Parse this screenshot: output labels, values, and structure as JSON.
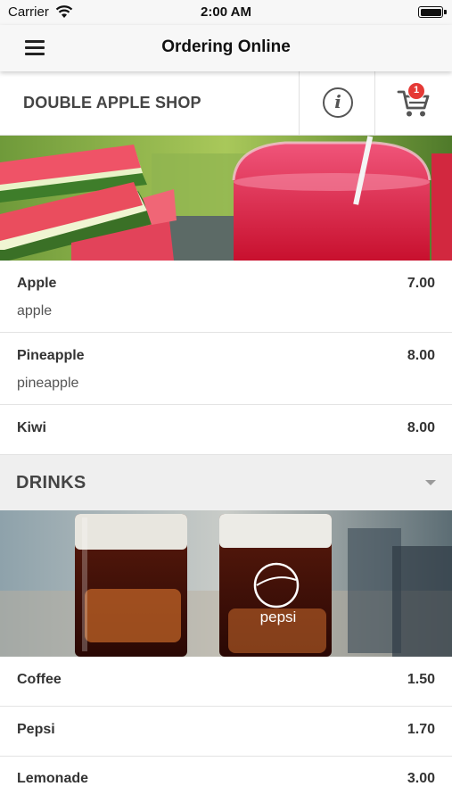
{
  "status_bar": {
    "carrier": "Carrier",
    "time": "2:00 AM"
  },
  "nav": {
    "title": "Ordering Online",
    "menu_icon": "hamburger-menu-icon"
  },
  "shop": {
    "name": "DOUBLE APPLE SHOP",
    "info_icon": "info-icon",
    "cart_icon": "shopping-cart-icon",
    "cart_count": "1"
  },
  "fruit_items": [
    {
      "name": "Apple",
      "description": "apple",
      "price": "7.00"
    },
    {
      "name": "Pineapple",
      "description": "pineapple",
      "price": "8.00"
    },
    {
      "name": "Kiwi",
      "description": "",
      "price": "8.00"
    }
  ],
  "drinks_category": {
    "title": "DRINKS",
    "chevron_icon": "chevron-down-icon",
    "items": [
      {
        "name": "Coffee",
        "price": "1.50"
      },
      {
        "name": "Pepsi",
        "price": "1.70"
      },
      {
        "name": "Lemonade",
        "price": "3.00"
      }
    ]
  },
  "banners": {
    "drinks_glass_logo_text": "pepsi"
  },
  "colors": {
    "badge": "#e53935",
    "nav_background": "#f7f7f7",
    "category_background": "#efefef"
  }
}
